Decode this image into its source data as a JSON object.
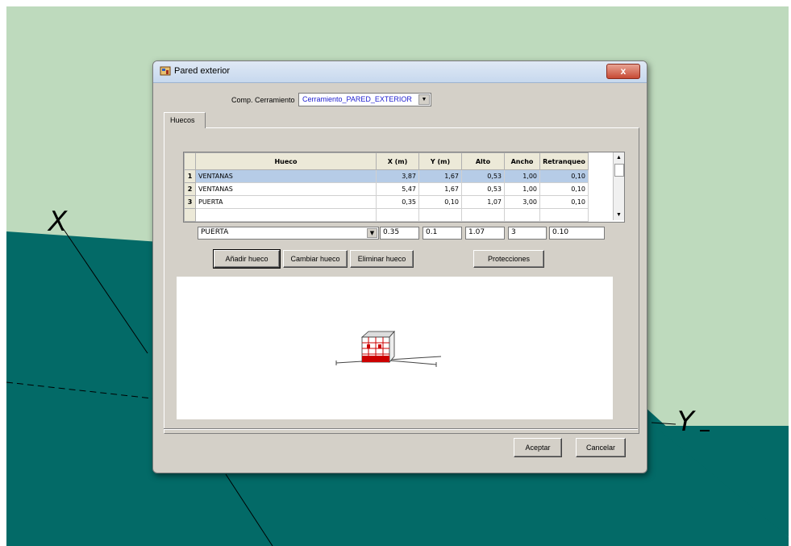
{
  "background": {
    "light_color": "#bedabd",
    "dark_color": "#036a67",
    "axis_x_label": "X",
    "axis_y_label": "Y"
  },
  "dialog": {
    "title": "Pared exterior",
    "close_symbol": "x",
    "comp_label": "Comp. Cerramiento",
    "comp_value": "Cerramiento_PARED_EXTERIOR",
    "tab_label": "Huecos",
    "grid": {
      "headers": [
        "Hueco",
        "X (m)",
        "Y (m)",
        "Alto",
        "Ancho",
        "Retranqueo"
      ],
      "rows": [
        {
          "num": "1",
          "hueco": "VENTANAS",
          "x": "3,87",
          "y": "1,67",
          "alto": "0,53",
          "ancho": "1,00",
          "retranqueo": "0,10"
        },
        {
          "num": "2",
          "hueco": "VENTANAS",
          "x": "5,47",
          "y": "1,67",
          "alto": "0,53",
          "ancho": "1,00",
          "retranqueo": "0,10"
        },
        {
          "num": "3",
          "hueco": "PUERTA",
          "x": "0,35",
          "y": "0,10",
          "alto": "1,07",
          "ancho": "3,00",
          "retranqueo": "0,10"
        }
      ],
      "selected_row": 1
    },
    "edit": {
      "hueco": "PUERTA",
      "x": "0.35",
      "y": "0.1",
      "alto": "1.07",
      "ancho": "3",
      "retranqueo": "0.10"
    },
    "buttons": {
      "anadir": "Añadir hueco",
      "cambiar": "Cambiar hueco",
      "eliminar": "Eliminar hueco",
      "protecciones": "Protecciones",
      "aceptar": "Aceptar",
      "cancelar": "Cancelar"
    }
  },
  "icons": {
    "title": "app-icon",
    "close": "close-icon",
    "dropdown": "chevron-down-icon"
  }
}
